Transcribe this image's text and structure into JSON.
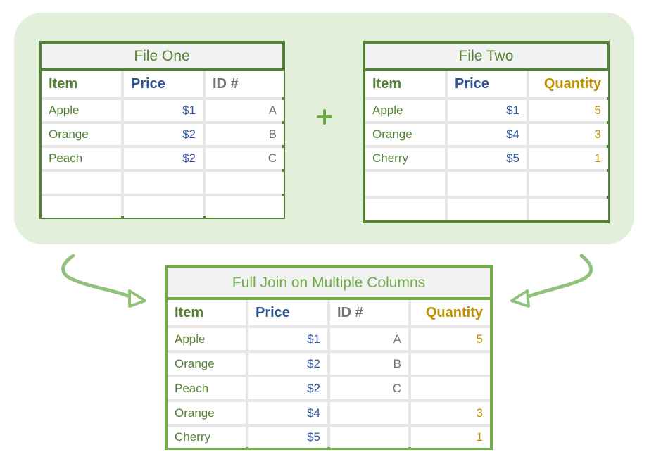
{
  "file_one": {
    "title": "File One",
    "headers": [
      "Item",
      "Price",
      "ID #"
    ],
    "rows": [
      [
        "Apple",
        "$1",
        "A"
      ],
      [
        "Orange",
        "$2",
        "B"
      ],
      [
        "Peach",
        "$2",
        "C"
      ],
      [
        "",
        "",
        ""
      ],
      [
        "",
        "",
        ""
      ]
    ]
  },
  "file_two": {
    "title": "File Two",
    "headers": [
      "Item",
      "Price",
      "Quantity"
    ],
    "rows": [
      [
        "Apple",
        "$1",
        "5"
      ],
      [
        "Orange",
        "$4",
        "3"
      ],
      [
        "Cherry",
        "$5",
        "1"
      ],
      [
        "",
        "",
        ""
      ],
      [
        "",
        "",
        ""
      ]
    ]
  },
  "operator": {
    "icon": "plus-icon"
  },
  "result": {
    "title": "Full Join on Multiple Columns",
    "headers": [
      "Item",
      "Price",
      "ID #",
      "Quantity"
    ],
    "rows": [
      [
        "Apple",
        "$1",
        "A",
        "5"
      ],
      [
        "Orange",
        "$2",
        "B",
        ""
      ],
      [
        "Peach",
        "$2",
        "C",
        ""
      ],
      [
        "Orange",
        "$4",
        "",
        "3"
      ],
      [
        "Cherry",
        "$5",
        "",
        "1"
      ]
    ]
  },
  "colors": {
    "panel_bg": "#e2efda",
    "border_dark": "#548235",
    "border_light": "#70ad47",
    "item": "#548235",
    "price": "#2f5597",
    "id": "#767171",
    "quantity": "#bf9000",
    "arrow": "#8fc27a"
  }
}
